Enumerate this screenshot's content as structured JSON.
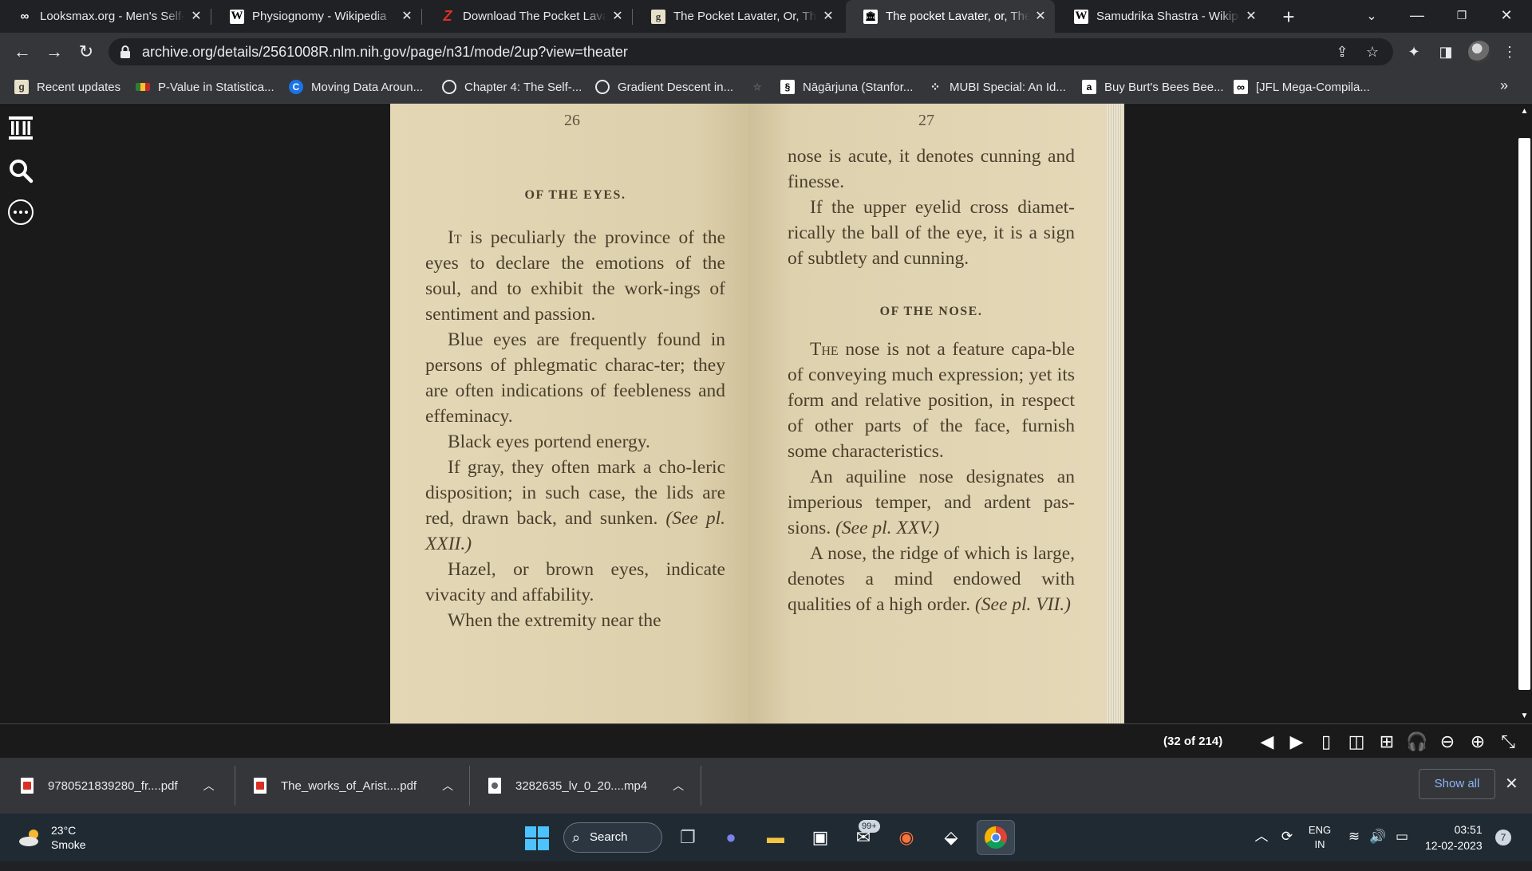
{
  "browser": {
    "tabs": [
      {
        "title": "Looksmax.org - Men's Self-I",
        "icon": "infinity-icon",
        "active": false
      },
      {
        "title": "Physiognomy - Wikipedia",
        "icon": "wikipedia-icon",
        "active": false
      },
      {
        "title": "Download The Pocket Lavat",
        "icon": "z-library-icon",
        "active": false
      },
      {
        "title": "The Pocket Lavater, Or, The",
        "icon": "goodreads-icon",
        "active": false
      },
      {
        "title": "The pocket Lavater, or, The",
        "icon": "internet-archive-icon",
        "active": true
      },
      {
        "title": "Samudrika Shastra - Wikipe",
        "icon": "wikipedia-icon",
        "active": false
      }
    ],
    "url": "archive.org/details/2561008R.nlm.nih.gov/page/n31/mode/2up?view=theater",
    "bookmarks": [
      "Recent updates",
      "P-Value in Statistica...",
      "Moving Data Aroun...",
      "Chapter 4: The Self-...",
      "Gradient Descent in...",
      "Nāgārjuna (Stanfor...",
      "MUBI Special: An Id...",
      "Buy Burt's Bees Bee...",
      "[JFL Mega-Compila..."
    ],
    "bookmark_more": "»"
  },
  "reader": {
    "left_page": {
      "number": "26",
      "heading": "OF THE EYES.",
      "paragraphs": [
        {
          "dropcap": "It",
          "text": " is peculiarly the province of the eyes to declare the emotions of the soul, and to exhibit the work-ings of sentiment and passion."
        },
        {
          "text": "Blue eyes are frequently found in persons of phlegmatic charac-ter; they are often indications of feebleness and effeminacy."
        },
        {
          "text": "Black eyes portend energy."
        },
        {
          "text": "If gray, they often mark a cho-leric disposition; in such case, the lids are red, drawn back, and sunken.",
          "ref": "(See pl. XXII.)"
        },
        {
          "text": "Hazel, or brown eyes, indicate vivacity and affability."
        },
        {
          "text": "When the extremity near the"
        }
      ]
    },
    "right_page": {
      "number": "27",
      "paragraphs_top": [
        {
          "text": "nose is acute, it denotes cunning and finesse.",
          "indent": false
        },
        {
          "text": "If the upper eyelid cross diamet-rically the ball of the eye, it is a sign of subtlety and cunning.",
          "indent": true
        }
      ],
      "heading": "OF THE NOSE.",
      "paragraphs": [
        {
          "dropcap": "The",
          "text": " nose is not a feature capa-ble of conveying much expression; yet its form and relative position, in respect of other parts of the face, furnish some characteristics."
        },
        {
          "text": "An aquiline nose designates an imperious temper, and ardent pas-sions.",
          "ref": "(See pl. XXV.)"
        },
        {
          "text": "A nose, the ridge of which is large, denotes a mind endowed with qualities of a high order.",
          "ref": "(See pl. VII.)"
        }
      ]
    },
    "page_counter": "(32 of 214)"
  },
  "downloads": [
    {
      "name": "9780521839280_fr....pdf",
      "type": "pdf"
    },
    {
      "name": "The_works_of_Arist....pdf",
      "type": "pdf"
    },
    {
      "name": "3282635_lv_0_20....mp4",
      "type": "video"
    }
  ],
  "downloads_show_all": "Show all",
  "taskbar": {
    "weather_temp": "23°C",
    "weather_condition": "Smoke",
    "search_label": "Search",
    "mail_badge": "99+",
    "language_line1": "ENG",
    "language_line2": "IN",
    "time": "03:51",
    "date": "12-02-2023",
    "notification_count": "7"
  }
}
